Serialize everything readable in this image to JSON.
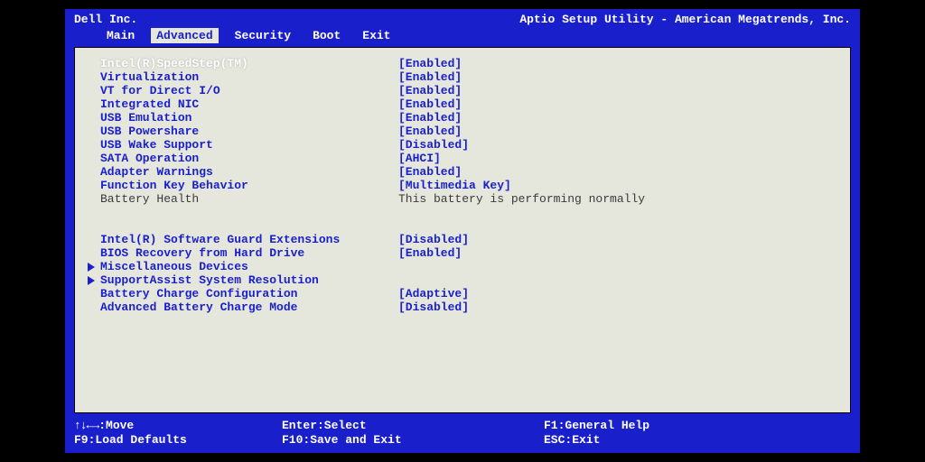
{
  "header": {
    "vendor": "Dell Inc.",
    "title": "Aptio Setup Utility - American Megatrends, Inc."
  },
  "tabs": [
    {
      "label": "Main",
      "active": false
    },
    {
      "label": "Advanced",
      "active": true
    },
    {
      "label": "Security",
      "active": false
    },
    {
      "label": "Boot",
      "active": false
    },
    {
      "label": "Exit",
      "active": false
    }
  ],
  "group1": [
    {
      "label": "Intel(R)SpeedStep(TM)",
      "value": "[Enabled]",
      "selected": true
    },
    {
      "label": "Virtualization",
      "value": "[Enabled]"
    },
    {
      "label": "VT for Direct I/O",
      "value": "[Enabled]"
    },
    {
      "label": "Integrated NIC",
      "value": "[Enabled]"
    },
    {
      "label": "USB Emulation",
      "value": "[Enabled]"
    },
    {
      "label": "USB Powershare",
      "value": "[Enabled]"
    },
    {
      "label": "USB Wake Support",
      "value": "[Disabled]"
    },
    {
      "label": "SATA Operation",
      "value": "[AHCI]"
    },
    {
      "label": "Adapter Warnings",
      "value": "[Enabled]"
    },
    {
      "label": "Function Key Behavior",
      "value": "[Multimedia Key]"
    },
    {
      "label": "Battery Health",
      "value": "This battery is performing normally",
      "muted": true
    }
  ],
  "group2": [
    {
      "label": "Intel(R) Software Guard Extensions",
      "value": "[Disabled]"
    },
    {
      "label": "BIOS Recovery from Hard Drive",
      "value": "[Enabled]"
    },
    {
      "label": "Miscellaneous Devices",
      "value": "",
      "submenu": true
    },
    {
      "label": "SupportAssist System Resolution",
      "value": "",
      "submenu": true
    },
    {
      "label": "Battery Charge Configuration",
      "value": "[Adaptive]"
    },
    {
      "label": "Advanced Battery Charge Mode",
      "value": "[Disabled]"
    }
  ],
  "footer": {
    "r1c1_prefix": "↑↓←→",
    "r1c1": ":Move",
    "r1c2": "Enter:Select",
    "r1c3": "F1:General Help",
    "r2c1": "F9:Load Defaults",
    "r2c2": "F10:Save and Exit",
    "r2c3": "ESC:Exit"
  }
}
